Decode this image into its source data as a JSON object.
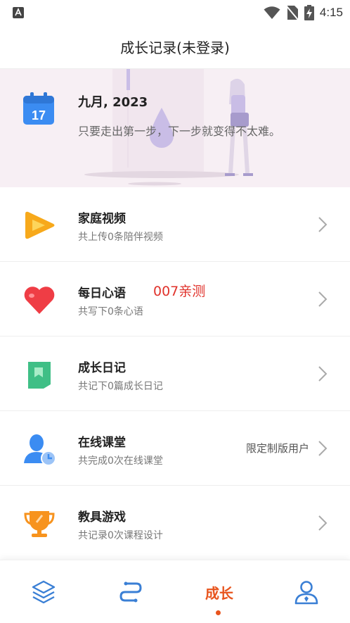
{
  "status_bar": {
    "time": "4:15"
  },
  "header": {
    "title": "成长记录(未登录)"
  },
  "banner": {
    "calendar_day": "17",
    "title": "九月, 2023",
    "subtitle": "只要走出第一步，下一步就变得不太难。"
  },
  "rows": [
    {
      "title": "家庭视频",
      "subtitle": "共上传0条陪伴视频",
      "icon": "video-play-icon"
    },
    {
      "title": "每日心语",
      "subtitle": "共写下0条心语",
      "tag": "007亲测",
      "icon": "heart-icon"
    },
    {
      "title": "成长日记",
      "subtitle": "共记下0篇成长日记",
      "icon": "diary-book-icon"
    },
    {
      "title": "在线课堂",
      "subtitle": "共完成0次在线课堂",
      "extra": "限定制版用户",
      "icon": "online-class-icon"
    },
    {
      "title": "教具游戏",
      "subtitle": "共记录0次课程设计",
      "icon": "trophy-icon"
    }
  ],
  "tabbar": {
    "active_label": "成长",
    "accent": "#e8541d",
    "icon_color": "#3a7fd5"
  }
}
